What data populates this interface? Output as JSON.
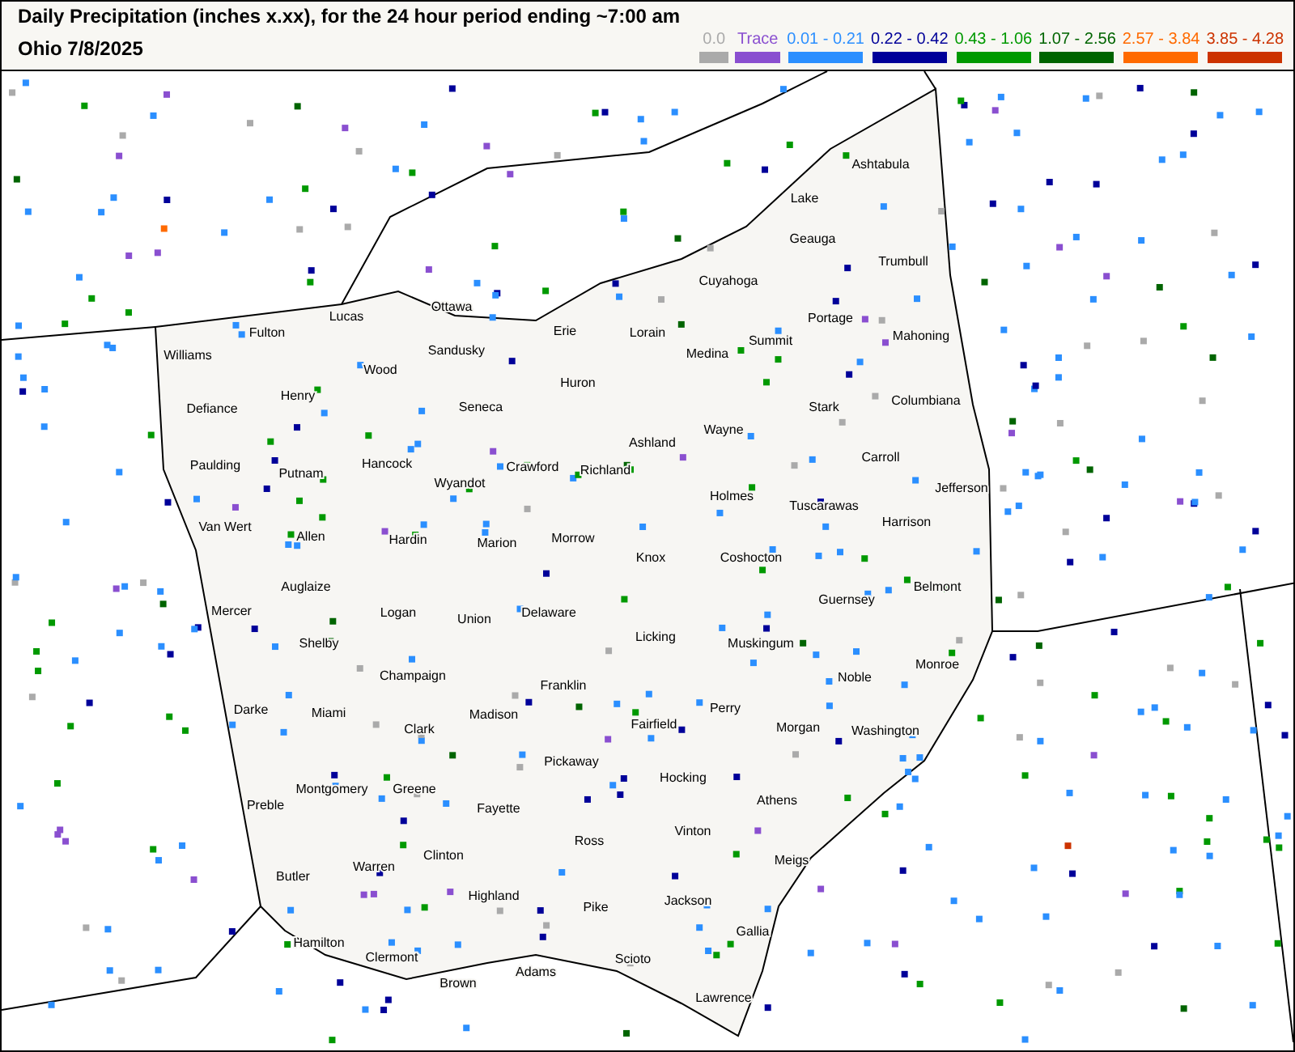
{
  "header": {
    "title": "Daily Precipitation (inches  x.xx),  for the 24 hour period ending ~7:00 am",
    "subtitle": "Ohio 7/8/2025"
  },
  "legend": [
    {
      "label": "0.0",
      "color": "#aaaaaa"
    },
    {
      "label": "Trace",
      "color": "#8a4fd0"
    },
    {
      "label": "0.01 - 0.21",
      "color": "#2b8fff"
    },
    {
      "label": "0.22 - 0.42",
      "color": "#000099"
    },
    {
      "label": "0.43 - 1.06",
      "color": "#009900"
    },
    {
      "label": "1.07 - 2.56",
      "color": "#006400"
    },
    {
      "label": "2.57 - 3.84",
      "color": "#ff6a00"
    },
    {
      "label": "3.85 - 4.28",
      "color": "#cc3300"
    }
  ],
  "counties": [
    "Ashtabula",
    "Lake",
    "Geauga",
    "Trumbull",
    "Cuyahoga",
    "Lucas",
    "Ottawa",
    "Erie",
    "Lorain",
    "Portage",
    "Williams",
    "Fulton",
    "Wood",
    "Sandusky",
    "Medina",
    "Summit",
    "Mahoning",
    "Defiance",
    "Henry",
    "Seneca",
    "Huron",
    "Columbiana",
    "Stark",
    "Ashland",
    "Wayne",
    "Paulding",
    "Putnam",
    "Hancock",
    "Crawford",
    "Richland",
    "Carroll",
    "Wyandot",
    "Holmes",
    "Jefferson",
    "Van Wert",
    "Allen",
    "Hardin",
    "Marion",
    "Morrow",
    "Tuscarawas",
    "Harrison",
    "Knox",
    "Coshocton",
    "Mercer",
    "Auglaize",
    "Logan",
    "Union",
    "Delaware",
    "Belmont",
    "Guernsey",
    "Licking",
    "Muskingum",
    "Shelby",
    "Champaign",
    "Franklin",
    "Noble",
    "Monroe",
    "Darke",
    "Miami",
    "Madison",
    "Clark",
    "Perry",
    "Fairfield",
    "Morgan",
    "Washington",
    "Montgomery",
    "Greene",
    "Fayette",
    "Pickaway",
    "Hocking",
    "Athens",
    "Preble",
    "Vinton",
    "Ross",
    "Clinton",
    "Butler",
    "Warren",
    "Meigs",
    "Highland",
    "Pike",
    "Jackson",
    "Hamilton",
    "Clermont",
    "Gallia",
    "Scioto",
    "Adams",
    "Brown",
    "Lawrence"
  ]
}
